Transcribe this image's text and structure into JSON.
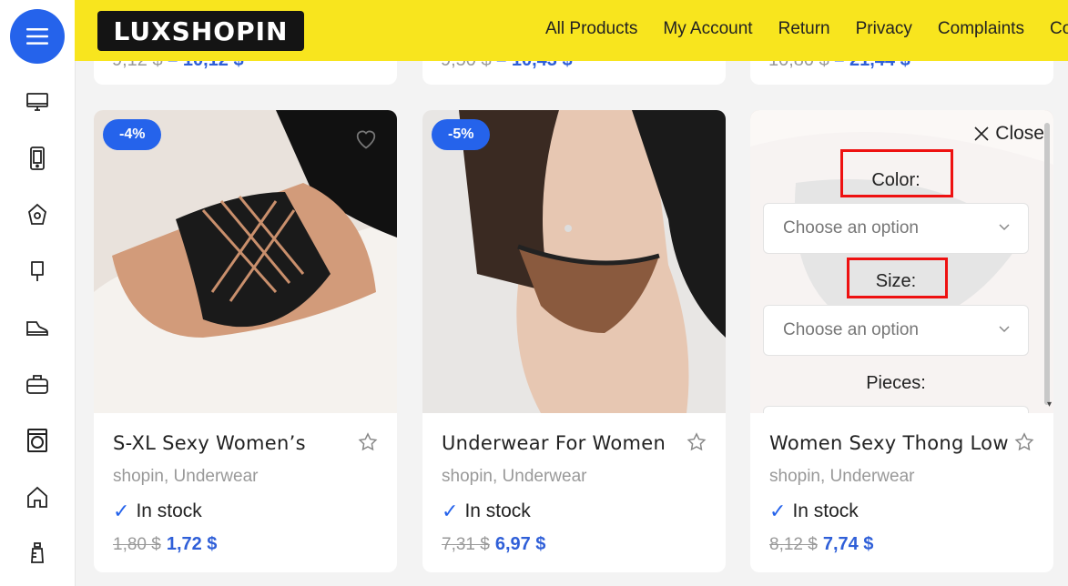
{
  "sidebar": {
    "icons": [
      "computer-icon",
      "phone-icon",
      "makeup-icon",
      "popsicle-icon",
      "shoe-icon",
      "bag-icon",
      "washing-machine-icon",
      "home-icon",
      "baby-bottle-icon"
    ]
  },
  "header": {
    "logo": "LUXSHOPIN",
    "nav": [
      "All Products",
      "My Account",
      "Return",
      "Privacy",
      "Complaints",
      "Co"
    ]
  },
  "top_cards": [
    {
      "old_price": "9,12 $",
      "new_price": "10,12 $"
    },
    {
      "old_price": "9,50 $",
      "new_price": "10,43 $"
    },
    {
      "old_price": "10,80 $",
      "new_price": "21,44 $"
    }
  ],
  "products": [
    {
      "badge": "-4%",
      "title": "S-XL Sexy Women’s",
      "category": "shopin, Underwear",
      "stock": "In stock",
      "old_price": "1,80 $",
      "new_price": "1,72 $"
    },
    {
      "badge": "-5%",
      "title": "Underwear For Women",
      "category": "shopin, Underwear",
      "stock": "In stock",
      "old_price": "7,31 $",
      "new_price": "6,97 $"
    },
    {
      "badge": "",
      "title": "Women Sexy Thong Low",
      "category": "shopin, Underwear",
      "stock": "In stock",
      "old_price": "8,12 $",
      "new_price": "7,74 $"
    }
  ],
  "variations": {
    "close_label": "Close",
    "color_label": "Color",
    "size_label": "Size",
    "pieces_label": "Pieces",
    "colon": ":",
    "select_placeholder": "Choose an option"
  },
  "colors": {
    "accent": "#2563eb",
    "header_bg": "#f8e51e",
    "highlight": "#ee1111"
  }
}
